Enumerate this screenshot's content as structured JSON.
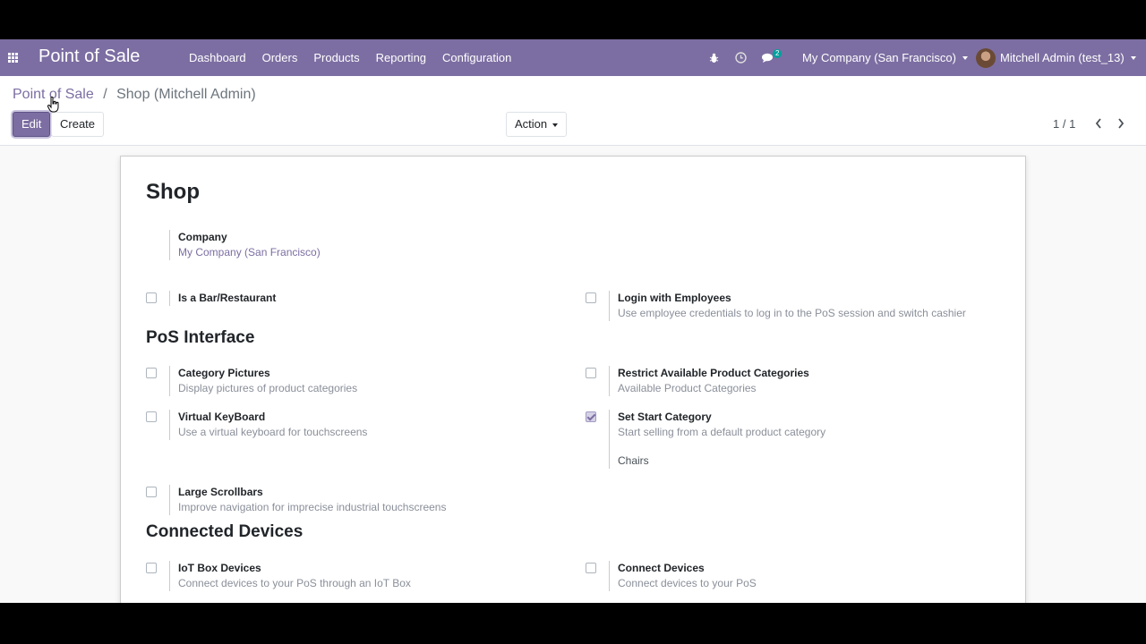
{
  "navbar": {
    "brand": "Point of Sale",
    "menu": [
      "Dashboard",
      "Orders",
      "Products",
      "Reporting",
      "Configuration"
    ],
    "chat_badge": "2",
    "company": "My Company (San Francisco)",
    "user": "Mitchell Admin (test_13)"
  },
  "breadcrumb": {
    "parent": "Point of Sale",
    "separator": "/",
    "current": "Shop (Mitchell Admin)"
  },
  "buttons": {
    "edit": "Edit",
    "create": "Create",
    "action": "Action"
  },
  "pager": {
    "value": "1 / 1"
  },
  "sheet": {
    "title": "Shop",
    "company": {
      "label": "Company",
      "value": "My Company (San Francisco)"
    },
    "general": [
      {
        "label": "Is a Bar/Restaurant",
        "desc": "",
        "checked": false
      },
      {
        "label": "Login with Employees",
        "desc": "Use employee credentials to log in to the PoS session and switch cashier",
        "checked": false
      }
    ],
    "pos_interface": {
      "heading": "PoS Interface",
      "items": [
        {
          "label": "Category Pictures",
          "desc": "Display pictures of product categories",
          "checked": false
        },
        {
          "label": "Restrict Available Product Categories",
          "desc": "Available Product Categories",
          "checked": false
        },
        {
          "label": "Virtual KeyBoard",
          "desc": "Use a virtual keyboard for touchscreens",
          "checked": false
        },
        {
          "label": "Set Start Category",
          "desc": "Start selling from a default product category",
          "value": "Chairs",
          "checked": true
        },
        {
          "label": "Large Scrollbars",
          "desc": "Improve navigation for imprecise industrial touchscreens",
          "checked": false
        }
      ]
    },
    "connected_devices": {
      "heading": "Connected Devices",
      "items": [
        {
          "label": "IoT Box Devices",
          "desc": "Connect devices to your PoS through an IoT Box",
          "checked": false
        },
        {
          "label": "Connect Devices",
          "desc": "Connect devices to your PoS",
          "checked": false
        }
      ]
    }
  },
  "colors": {
    "primary": "#7c6ea2",
    "badge": "#00a09d"
  }
}
